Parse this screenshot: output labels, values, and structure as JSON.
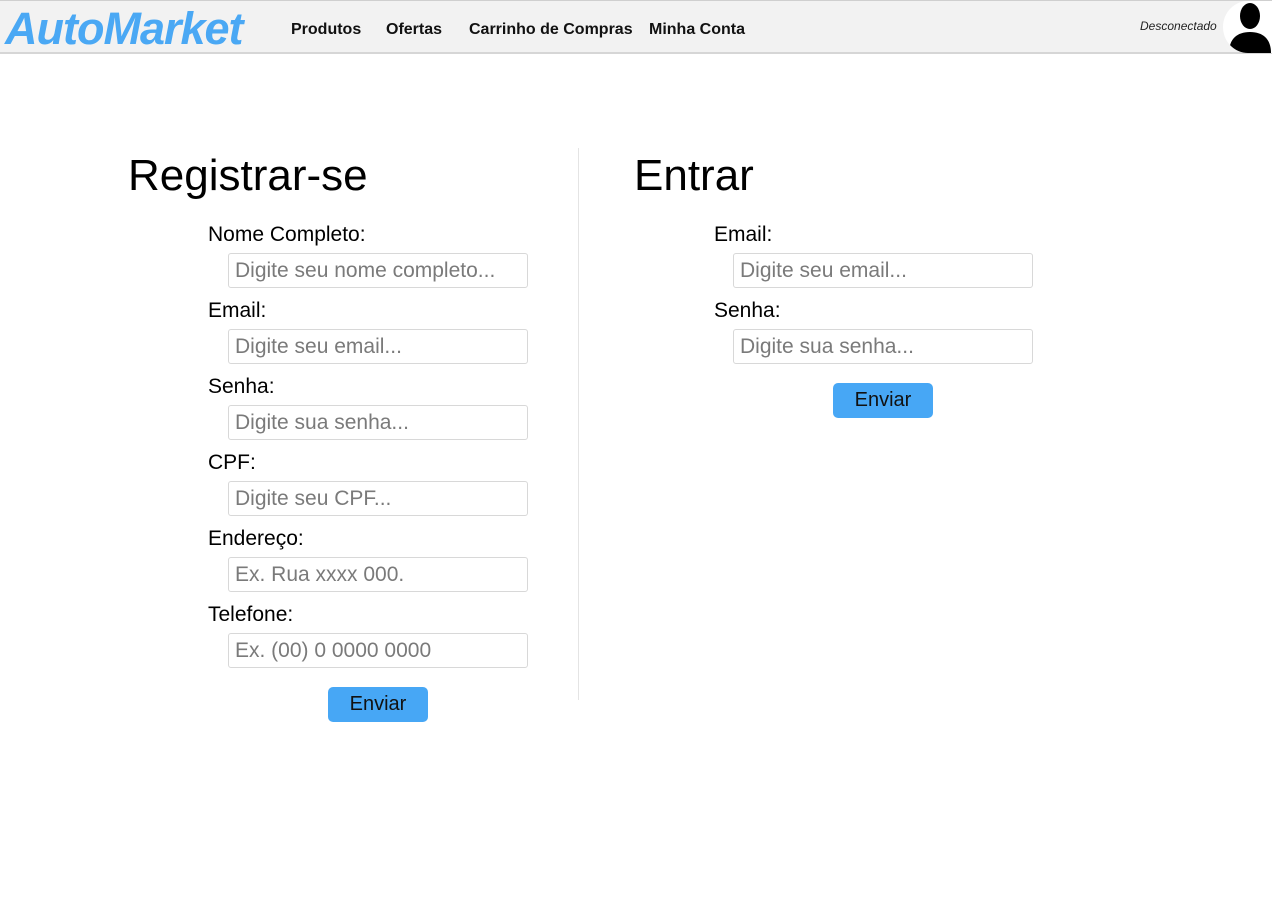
{
  "header": {
    "logo": "AutoMarket",
    "nav": [
      "Produtos",
      "Ofertas",
      "Carrinho de Compras",
      "Minha Conta"
    ],
    "status": "Desconectado",
    "avatar_icon": "user-silhouette-icon"
  },
  "register": {
    "title": "Registrar-se",
    "fields": [
      {
        "label": "Nome Completo:",
        "placeholder": "Digite seu nome completo..."
      },
      {
        "label": "Email:",
        "placeholder": "Digite seu email..."
      },
      {
        "label": "Senha:",
        "placeholder": "Digite sua senha..."
      },
      {
        "label": "CPF:",
        "placeholder": "Digite seu CPF..."
      },
      {
        "label": "Endereço:",
        "placeholder": "Ex. Rua xxxx 000."
      },
      {
        "label": "Telefone:",
        "placeholder": "Ex. (00) 0 0000 0000"
      }
    ],
    "submit": "Enviar"
  },
  "login": {
    "title": "Entrar",
    "fields": [
      {
        "label": "Email:",
        "placeholder": "Digite seu email..."
      },
      {
        "label": "Senha:",
        "placeholder": "Digite sua senha..."
      }
    ],
    "submit": "Enviar"
  },
  "colors": {
    "brand": "#4aa8f4",
    "button": "#47a7f5",
    "topbar": "#f2f2f2"
  }
}
